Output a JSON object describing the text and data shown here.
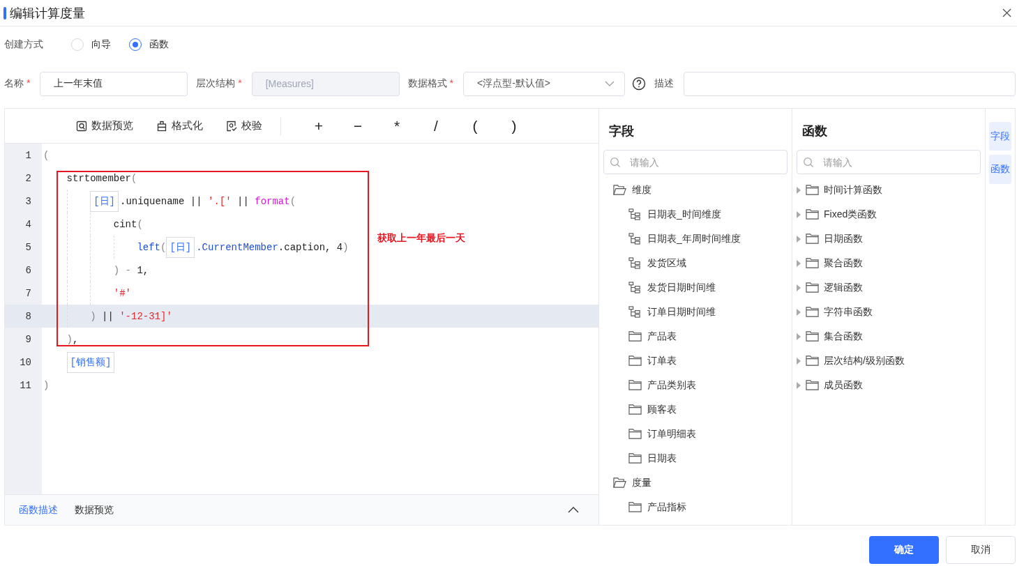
{
  "window": {
    "title": "编辑计算度量"
  },
  "creation": {
    "label": "创建方式",
    "options": [
      {
        "label": "向导",
        "selected": false
      },
      {
        "label": "函数",
        "selected": true
      }
    ]
  },
  "form": {
    "name": {
      "label": "名称",
      "required": true,
      "value": "上一年末值"
    },
    "hierarchy": {
      "label": "层次结构",
      "required": true,
      "value": "[Measures]",
      "disabled": true
    },
    "format": {
      "label": "数据格式",
      "required": true,
      "value": "<浮点型-默认值>"
    },
    "description": {
      "label": "描述"
    }
  },
  "toolbar": {
    "actions": [
      {
        "label": "数据预览",
        "kind": "preview"
      },
      {
        "label": "格式化",
        "kind": "format"
      },
      {
        "label": "校验",
        "kind": "check"
      }
    ],
    "operators": [
      "+",
      "−",
      "*",
      "/",
      "(",
      ")"
    ]
  },
  "code": {
    "lines": [
      {
        "number": "1",
        "active": false,
        "tokens": [
          {
            "kind": "paren",
            "text": "("
          }
        ],
        "children": [
          {
            "number": "2",
            "active": false,
            "tokens": [
              {
                "kind": "text",
                "text": "strtomember"
              },
              {
                "kind": "paren",
                "text": "("
              }
            ],
            "children": [
              {
                "number": "3",
                "active": false,
                "tokens": [
                  {
                    "kind": "field",
                    "text": "[日]"
                  },
                  {
                    "kind": "text",
                    "text": ".uniquename || "
                  },
                  {
                    "kind": "string",
                    "text": "'.['"
                  },
                  {
                    "kind": "text",
                    "text": " || "
                  },
                  {
                    "kind": "func",
                    "text": "format"
                  },
                  {
                    "kind": "paren",
                    "text": "("
                  }
                ],
                "children": [
                  {
                    "number": "4",
                    "active": false,
                    "tokens": [
                      {
                        "kind": "text",
                        "text": "cint"
                      },
                      {
                        "kind": "paren",
                        "text": "("
                      }
                    ],
                    "children": [
                      {
                        "number": "5",
                        "active": false,
                        "tokens": [
                          {
                            "kind": "member",
                            "text": "left"
                          },
                          {
                            "kind": "paren",
                            "text": "("
                          },
                          {
                            "kind": "field",
                            "text": "[日]"
                          },
                          {
                            "kind": "member",
                            "text": ".CurrentMember"
                          },
                          {
                            "kind": "text",
                            "text": ".caption, 4"
                          },
                          {
                            "kind": "paren",
                            "text": ")"
                          }
                        ]
                      }
                    ]
                  },
                  {
                    "number": "6",
                    "active": false,
                    "tokens": [
                      {
                        "kind": "paren",
                        "text": ") - "
                      },
                      {
                        "kind": "text",
                        "text": "1,"
                      }
                    ]
                  },
                  {
                    "number": "7",
                    "active": false,
                    "tokens": [
                      {
                        "kind": "string",
                        "text": "'#'"
                      }
                    ]
                  }
                ]
              },
              {
                "number": "8",
                "active": true,
                "tokens": [
                  {
                    "kind": "paren",
                    "text": ")"
                  },
                  {
                    "kind": "text",
                    "text": " || "
                  },
                  {
                    "kind": "string",
                    "text": "'-12-31]'"
                  }
                ]
              }
            ]
          },
          {
            "number": "9",
            "active": false,
            "tokens": [
              {
                "kind": "paren",
                "text": ")"
              },
              {
                "kind": "text",
                "text": ","
              }
            ]
          },
          {
            "number": "10",
            "active": false,
            "tokens": [
              {
                "kind": "field",
                "text": "[销售额]"
              }
            ]
          }
        ]
      },
      {
        "number": "11",
        "active": false,
        "tokens": [
          {
            "kind": "paren",
            "text": ")"
          }
        ]
      }
    ],
    "annotation": "获取上一年最后一天"
  },
  "bottom_tabs": [
    {
      "label": "函数描述",
      "selected": true
    },
    {
      "label": "数据预览",
      "selected": false
    }
  ],
  "fields": {
    "title": "字段",
    "search": {
      "placeholder": "请输入"
    },
    "tree": [
      {
        "label": "维度",
        "expanded": true,
        "children": [
          {
            "label": "日期表_时间维度",
            "kind": "hierarchy"
          },
          {
            "label": "日期表_年周时间维度",
            "kind": "hierarchy"
          },
          {
            "label": "发货区域",
            "kind": "hierarchy"
          },
          {
            "label": "发货日期时间维",
            "kind": "hierarchy"
          },
          {
            "label": "订单日期时间维",
            "kind": "hierarchy"
          },
          {
            "label": "产品表",
            "kind": "table"
          },
          {
            "label": "订单表",
            "kind": "table"
          },
          {
            "label": "产品类别表",
            "kind": "table"
          },
          {
            "label": "顾客表",
            "kind": "table"
          },
          {
            "label": "订单明细表",
            "kind": "table"
          },
          {
            "label": "日期表",
            "kind": "table"
          }
        ]
      },
      {
        "label": "度量",
        "expanded": true,
        "children": [
          {
            "label": "产品指标",
            "kind": "table"
          }
        ]
      }
    ]
  },
  "functions": {
    "title": "函数",
    "search": {
      "placeholder": "请输入"
    },
    "tree": [
      {
        "label": "时间计算函数",
        "expanded": false
      },
      {
        "label": "Fixed类函数",
        "expanded": false
      },
      {
        "label": "日期函数",
        "expanded": false
      },
      {
        "label": "聚合函数",
        "expanded": false
      },
      {
        "label": "逻辑函数",
        "expanded": false
      },
      {
        "label": "字符串函数",
        "expanded": false
      },
      {
        "label": "集合函数",
        "expanded": false
      },
      {
        "label": "层次结构/级别函数",
        "expanded": false
      },
      {
        "label": "成员函数",
        "expanded": false
      }
    ]
  },
  "side_tabs": [
    {
      "label": "字段",
      "selected": true
    },
    {
      "label": "函数",
      "selected": true
    }
  ],
  "buttons": [
    {
      "label": "确定",
      "kind": "primary"
    },
    {
      "label": "取消",
      "kind": "secondary"
    }
  ]
}
